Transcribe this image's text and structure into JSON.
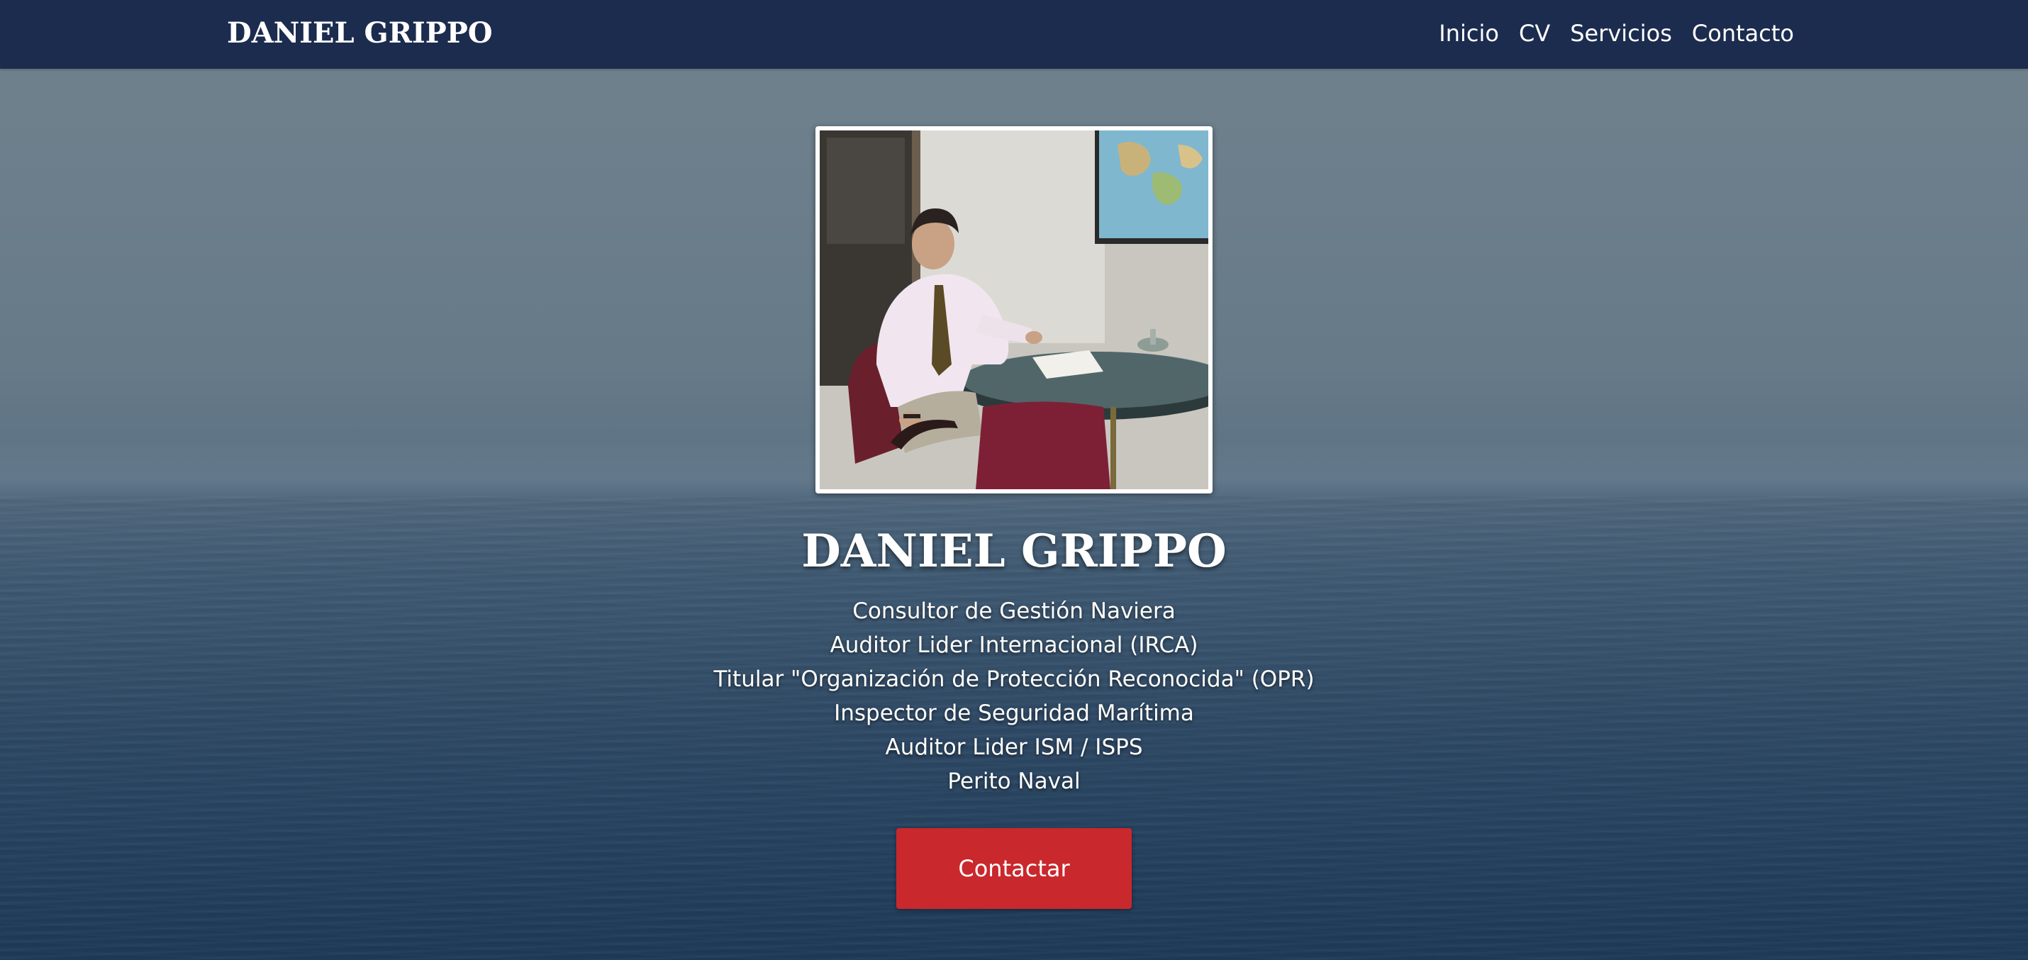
{
  "navbar": {
    "brand": "DANIEL GRIPPO",
    "links": [
      {
        "label": "Inicio"
      },
      {
        "label": "CV"
      },
      {
        "label": "Servicios"
      },
      {
        "label": "Contacto"
      }
    ],
    "background_color": "#1c2c4e"
  },
  "hero": {
    "photo_alt": "Daniel Grippo",
    "title": "DANIEL GRIPPO",
    "roles": [
      "Consultor de Gestión Naviera",
      "Auditor Lider Internacional (IRCA)",
      "Titular \"Organización de Protección Reconocida\" (OPR)",
      "Inspector de Seguridad Marítima",
      "Auditor Lider ISM / ISPS",
      "Perito Naval"
    ],
    "cta_label": "Contactar",
    "cta_color": "#c9282d"
  }
}
